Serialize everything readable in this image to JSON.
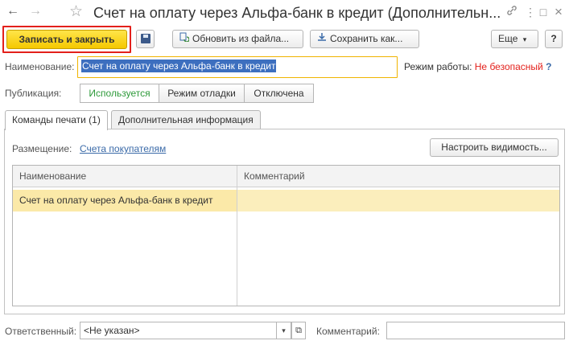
{
  "window": {
    "title": "Счет на оплату через Альфа-банк в кредит (Дополнительн...",
    "back_icon": "←",
    "forward_icon": "→",
    "star_icon": "☆",
    "link_icon": "🔗",
    "menu_icon": "⋮",
    "restore_icon": "□",
    "close_icon": "×"
  },
  "toolbar": {
    "save_close_label": "Записать и закрыть",
    "refresh_label": "Обновить из файла...",
    "save_as_label": "Сохранить как...",
    "more_label": "Еще",
    "more_arrow": "▾",
    "help_label": "?"
  },
  "form": {
    "name_label": "Наименование:",
    "name_value": "Счет на оплату через Альфа-банк в кредит",
    "mode_label": "Режим работы:",
    "mode_value": "Не безопасный",
    "mode_help": "?",
    "publication_label": "Публикация:",
    "publication_options": [
      "Используется",
      "Режим отладки",
      "Отключена"
    ]
  },
  "tabs": [
    {
      "label": "Команды печати (1)"
    },
    {
      "label": "Дополнительная информация"
    }
  ],
  "print_commands": {
    "placement_label": "Размещение:",
    "placement_link": "Счета покупателям",
    "visibility_button": "Настроить видимость...",
    "columns": [
      "Наименование",
      "Комментарий"
    ],
    "rows": [
      {
        "name": "Счет на оплату через Альфа-банк в кредит",
        "comment": ""
      }
    ]
  },
  "footer": {
    "responsible_label": "Ответственный:",
    "responsible_value": "<Не указан>",
    "responsible_dropdown": "▾",
    "responsible_open": "⧉",
    "comment_label": "Комментарий:",
    "comment_value": ""
  }
}
